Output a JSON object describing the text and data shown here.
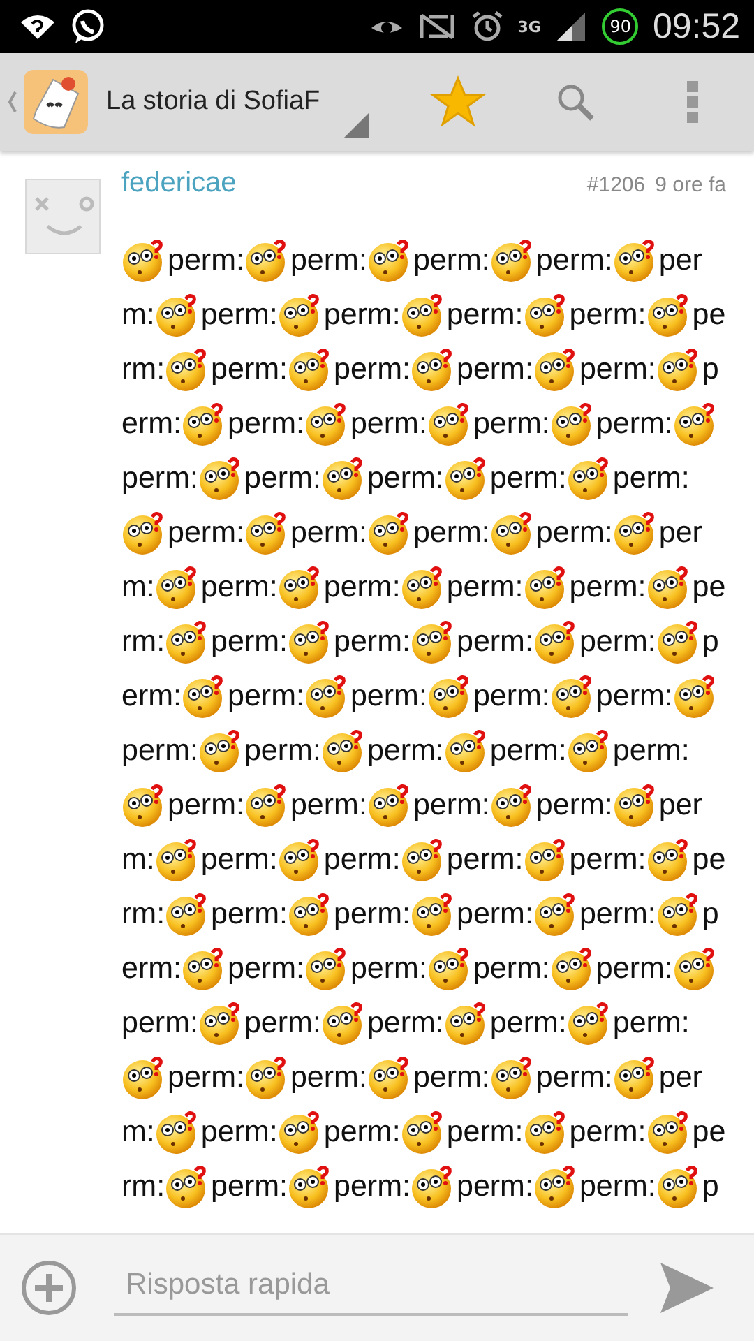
{
  "status_bar": {
    "network": "3G",
    "battery": "90",
    "time": "09:52"
  },
  "action_bar": {
    "title": "La storia di SofiaF",
    "starred": true
  },
  "post": {
    "author": "federicae",
    "number": "#1206",
    "time": "9 ore fa",
    "lines": [
      [
        {
          "emoji": true,
          "text": "perm:"
        },
        {
          "emoji": true,
          "text": "perm:"
        },
        {
          "emoji": true,
          "text": "perm:"
        },
        {
          "emoji": true,
          "text": "perm:"
        },
        {
          "emoji": true,
          "text": "per"
        }
      ],
      [
        {
          "emoji": false,
          "text": "m:"
        },
        {
          "emoji": true,
          "text": "perm:"
        },
        {
          "emoji": true,
          "text": "perm:"
        },
        {
          "emoji": true,
          "text": "perm:"
        },
        {
          "emoji": true,
          "text": "perm:"
        },
        {
          "emoji": true,
          "text": "pe"
        }
      ],
      [
        {
          "emoji": false,
          "text": "rm:"
        },
        {
          "emoji": true,
          "text": "perm:"
        },
        {
          "emoji": true,
          "text": "perm:"
        },
        {
          "emoji": true,
          "text": "perm:"
        },
        {
          "emoji": true,
          "text": "perm:"
        },
        {
          "emoji": true,
          "text": "p"
        }
      ],
      [
        {
          "emoji": false,
          "text": "erm:"
        },
        {
          "emoji": true,
          "text": "perm:"
        },
        {
          "emoji": true,
          "text": "perm:"
        },
        {
          "emoji": true,
          "text": "perm:"
        },
        {
          "emoji": true,
          "text": "perm:"
        },
        {
          "emoji": true
        }
      ],
      [
        {
          "emoji": false,
          "text": "perm:"
        },
        {
          "emoji": true,
          "text": "perm:"
        },
        {
          "emoji": true,
          "text": "perm:"
        },
        {
          "emoji": true,
          "text": "perm:"
        },
        {
          "emoji": true,
          "text": "perm:"
        }
      ],
      [
        {
          "emoji": true,
          "text": "perm:"
        },
        {
          "emoji": true,
          "text": "perm:"
        },
        {
          "emoji": true,
          "text": "perm:"
        },
        {
          "emoji": true,
          "text": "perm:"
        },
        {
          "emoji": true,
          "text": "per"
        }
      ],
      [
        {
          "emoji": false,
          "text": "m:"
        },
        {
          "emoji": true,
          "text": "perm:"
        },
        {
          "emoji": true,
          "text": "perm:"
        },
        {
          "emoji": true,
          "text": "perm:"
        },
        {
          "emoji": true,
          "text": "perm:"
        },
        {
          "emoji": true,
          "text": "pe"
        }
      ],
      [
        {
          "emoji": false,
          "text": "rm:"
        },
        {
          "emoji": true,
          "text": "perm:"
        },
        {
          "emoji": true,
          "text": "perm:"
        },
        {
          "emoji": true,
          "text": "perm:"
        },
        {
          "emoji": true,
          "text": "perm:"
        },
        {
          "emoji": true,
          "text": "p"
        }
      ],
      [
        {
          "emoji": false,
          "text": "erm:"
        },
        {
          "emoji": true,
          "text": "perm:"
        },
        {
          "emoji": true,
          "text": "perm:"
        },
        {
          "emoji": true,
          "text": "perm:"
        },
        {
          "emoji": true,
          "text": "perm:"
        },
        {
          "emoji": true
        }
      ],
      [
        {
          "emoji": false,
          "text": "perm:"
        },
        {
          "emoji": true,
          "text": "perm:"
        },
        {
          "emoji": true,
          "text": "perm:"
        },
        {
          "emoji": true,
          "text": "perm:"
        },
        {
          "emoji": true,
          "text": "perm:"
        }
      ],
      [
        {
          "emoji": true,
          "text": "perm:"
        },
        {
          "emoji": true,
          "text": "perm:"
        },
        {
          "emoji": true,
          "text": "perm:"
        },
        {
          "emoji": true,
          "text": "perm:"
        },
        {
          "emoji": true,
          "text": "per"
        }
      ],
      [
        {
          "emoji": false,
          "text": "m:"
        },
        {
          "emoji": true,
          "text": "perm:"
        },
        {
          "emoji": true,
          "text": "perm:"
        },
        {
          "emoji": true,
          "text": "perm:"
        },
        {
          "emoji": true,
          "text": "perm:"
        },
        {
          "emoji": true,
          "text": "pe"
        }
      ],
      [
        {
          "emoji": false,
          "text": "rm:"
        },
        {
          "emoji": true,
          "text": "perm:"
        },
        {
          "emoji": true,
          "text": "perm:"
        },
        {
          "emoji": true,
          "text": "perm:"
        },
        {
          "emoji": true,
          "text": "perm:"
        },
        {
          "emoji": true,
          "text": "p"
        }
      ],
      [
        {
          "emoji": false,
          "text": "erm:"
        },
        {
          "emoji": true,
          "text": "perm:"
        },
        {
          "emoji": true,
          "text": "perm:"
        },
        {
          "emoji": true,
          "text": "perm:"
        },
        {
          "emoji": true,
          "text": "perm:"
        },
        {
          "emoji": true
        }
      ],
      [
        {
          "emoji": false,
          "text": "perm:"
        },
        {
          "emoji": true,
          "text": "perm:"
        },
        {
          "emoji": true,
          "text": "perm:"
        },
        {
          "emoji": true,
          "text": "perm:"
        },
        {
          "emoji": true,
          "text": "perm:"
        }
      ],
      [
        {
          "emoji": true,
          "text": "perm:"
        },
        {
          "emoji": true,
          "text": "perm:"
        },
        {
          "emoji": true,
          "text": "perm:"
        },
        {
          "emoji": true,
          "text": "perm:"
        },
        {
          "emoji": true,
          "text": "per"
        }
      ],
      [
        {
          "emoji": false,
          "text": "m:"
        },
        {
          "emoji": true,
          "text": "perm:"
        },
        {
          "emoji": true,
          "text": "perm:"
        },
        {
          "emoji": true,
          "text": "perm:"
        },
        {
          "emoji": true,
          "text": "perm:"
        },
        {
          "emoji": true,
          "text": "pe"
        }
      ],
      [
        {
          "emoji": false,
          "text": "rm:"
        },
        {
          "emoji": true,
          "text": "perm:"
        },
        {
          "emoji": true,
          "text": "perm:"
        },
        {
          "emoji": true,
          "text": "perm:"
        },
        {
          "emoji": true,
          "text": "perm:"
        },
        {
          "emoji": true,
          "text": "p"
        }
      ]
    ]
  },
  "reply": {
    "placeholder": "Risposta rapida"
  }
}
